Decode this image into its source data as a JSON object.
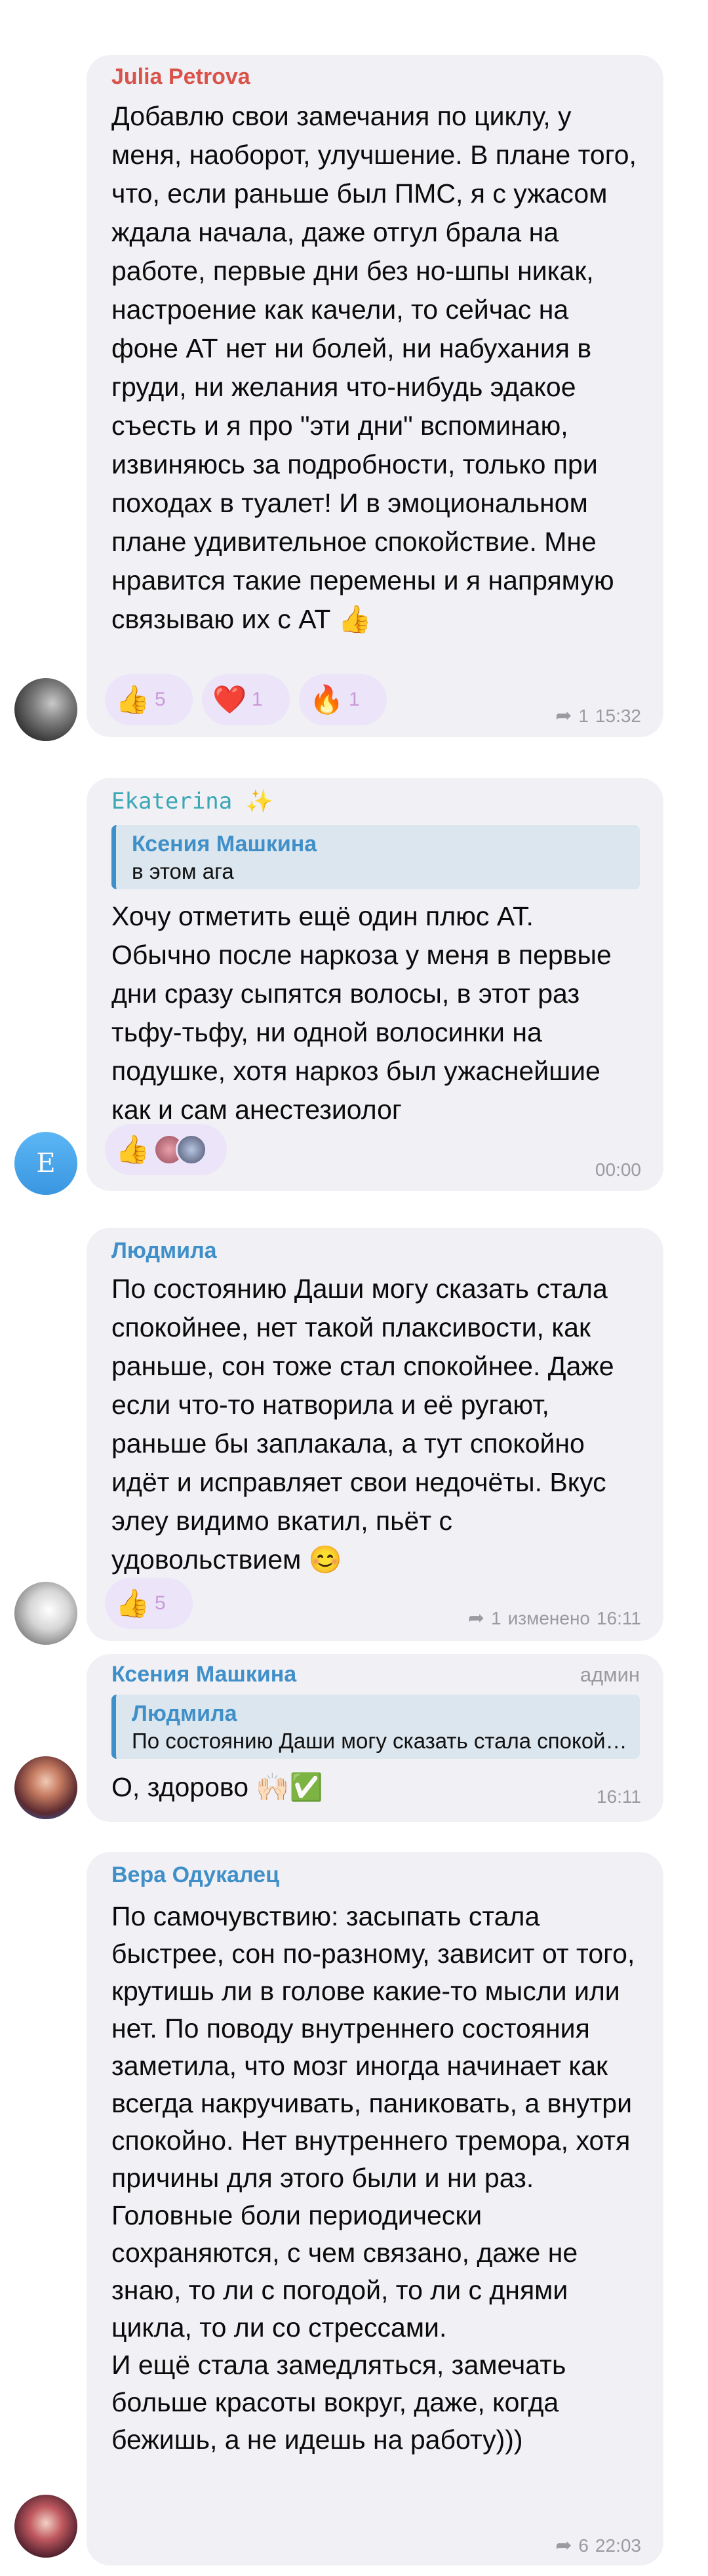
{
  "messages": [
    {
      "sender": "Julia Petrova",
      "text": "Добавлю свои замечания по циклу, у меня, наоборот, улучшение. В плане того, что, если раньше был ПМС, я с ужасом ждала начала, даже отгул брала на работе, первые дни без но-шпы никак, настроение как качели, то сейчас на фоне АТ нет ни болей, ни набухания в груди, ни желания что-нибудь эдакое съесть и я про \"эти дни\" вспоминаю, извиняюсь за подробности, только при походах в туалет! И в эмоциональном плане удивительное спокойствие. Мне нравится такие перемены и я напрямую связываю их с АТ 👍",
      "reactions": [
        {
          "emoji": "👍",
          "count": "5"
        },
        {
          "emoji": "❤️",
          "count": "1"
        },
        {
          "emoji": "🔥",
          "count": "1"
        }
      ],
      "forwards": "1",
      "time": "15:32"
    },
    {
      "sender": "Ekaterina ✨",
      "reply_name": "Ксения Машкина",
      "reply_text": "в этом ага",
      "text": "Хочу отметить ещё один плюс АТ. Обычно после наркоза у меня в первые дни сразу сыпятся волосы, в этот раз тьфу-тьфу, ни одной волосинки на подушке, хотя наркоз был ужаснейшие как и сам анестезиолог",
      "reactions": [
        {
          "emoji": "👍"
        }
      ],
      "avatar_letter": "E",
      "time": "00:00"
    },
    {
      "sender": "Людмила",
      "text": "По состоянию Даши могу сказать стала спокойнее, нет такой плаксивости, как раньше, сон тоже стал спокойнее. Даже если что-то натворила и её ругают, раньше бы заплакала, а тут спокойно идёт и исправляет свои недочёты. Вкус элеу видимо вкатил, пьёт с удовольствием 😊",
      "reactions": [
        {
          "emoji": "👍",
          "count": "5"
        }
      ],
      "forwards": "1",
      "edited": "изменено",
      "time": "16:11"
    },
    {
      "sender": "Ксения Машкина",
      "role": "админ",
      "reply_name": "Людмила",
      "reply_text": "По состоянию Даши могу сказать стала спокойнее, нет такой плаксивости, как раньше",
      "text": "О, здорово 🙌🏻✅",
      "time": "16:11"
    },
    {
      "sender": "Вера Одукалец",
      "text_lines": [
        "По самочувствию: засыпать стала быстрее, сон по-разному, зависит от того, крутишь ли в голове какие-то мысли или нет. По поводу внутреннего состояния заметила, что мозг иногда начинает как всегда накручивать, паниковать, а внутри спокойно. Нет внутреннего тремора, хотя причины для этого были и ни раз.",
        "Головные боли периодически сохраняются, с чем связано, даже не знаю, то ли с погодой, то ли с днями цикла, то ли со стрессами.",
        "И ещё стала замедляться, замечать больше красоты вокруг, даже, когда бежишь, а не идешь на работу)))"
      ],
      "forwards": "6",
      "time": "22:03"
    }
  ],
  "colors": {
    "bubble": "#f1f0f5",
    "julia": "#d9534a",
    "ekaterina": "#3aa7b5",
    "blue_name": "#3f8fc9",
    "reaction_bg": "#ece4f9",
    "reply_bg": "#dce6ee"
  }
}
